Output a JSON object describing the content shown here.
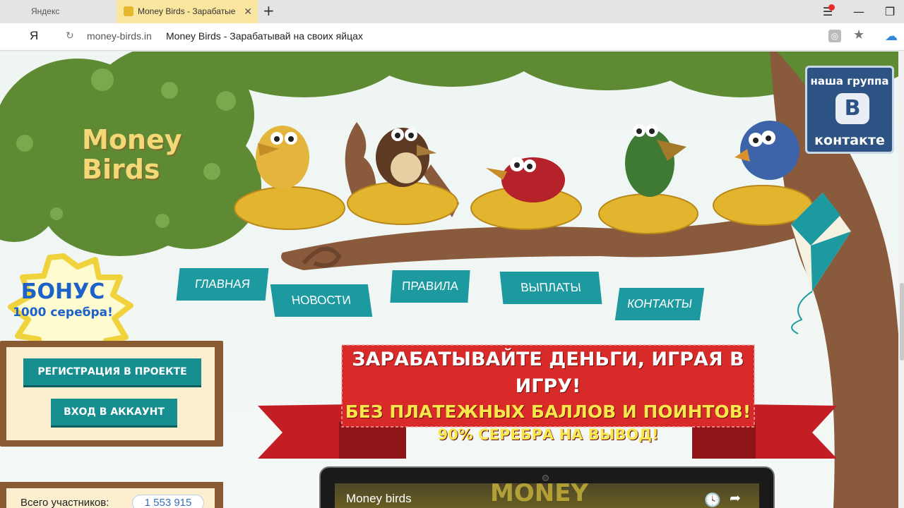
{
  "browser": {
    "tabs": [
      {
        "label": "Яндекс"
      },
      {
        "label": "Money Birds - Зарабатые"
      }
    ],
    "new_tab_symbol": "+",
    "close_symbol": "✕",
    "ya_button": "Я",
    "url_domain": "money-birds.in",
    "url_title": "Money Birds - Зарабатывай на своих яйцах"
  },
  "site": {
    "logo_line1": "Money",
    "logo_line2": "Birds",
    "vk": {
      "top": "наша группа",
      "logo": "B",
      "bottom": "контакте"
    },
    "nav": [
      "ГЛАВНАЯ",
      "НОВОСТИ",
      "ПРАВИЛА",
      "ВЫПЛАТЫ",
      "КОНТАКТЫ"
    ],
    "bonus": {
      "title": "БОНУС",
      "subtitle": "1000 серебра!"
    },
    "auth": {
      "register": "РЕГИСТРАЦИЯ В ПРОЕКТЕ",
      "login": "ВХОД В АККАУНТ"
    },
    "stats": {
      "label": "Всего участников:",
      "value": "1 553 915"
    },
    "banner": {
      "line1": "ЗАРАБАТЫВАЙТЕ ДЕНЬГИ, ИГРАЯ В ИГРУ!",
      "line2": "БЕЗ ПЛАТЕЖНЫХ БАЛЛОВ И ПОИНТОВ!",
      "line3": "90% СЕРЕБРА НА ВЫВОД!"
    },
    "video": {
      "title": "Money birds",
      "background_text": "MONEY"
    }
  },
  "colors": {
    "accent_teal": "#1d9aa0",
    "banner_red": "#d92a2a",
    "tree_green": "#5e8a33",
    "branch_brown": "#8a5a3c",
    "vk_blue": "#2c5383"
  }
}
